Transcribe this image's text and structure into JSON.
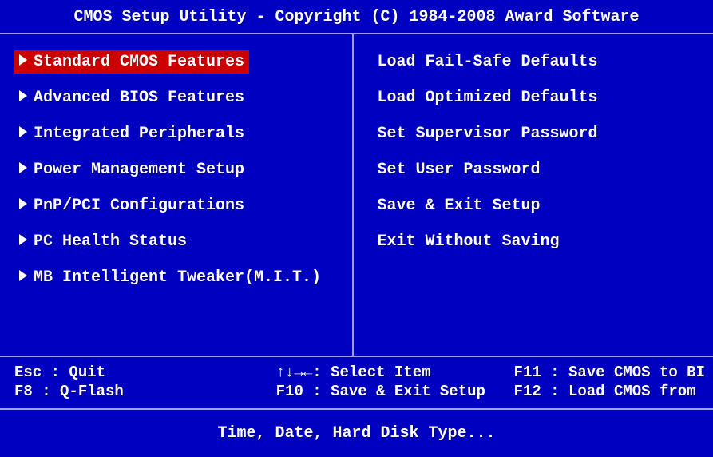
{
  "title": "CMOS Setup Utility - Copyright (C) 1984-2008 Award Software",
  "left_menu": [
    {
      "label": "Standard CMOS Features",
      "selected": true
    },
    {
      "label": "Advanced BIOS Features",
      "selected": false
    },
    {
      "label": "Integrated Peripherals",
      "selected": false
    },
    {
      "label": "Power Management Setup",
      "selected": false
    },
    {
      "label": "PnP/PCI Configurations",
      "selected": false
    },
    {
      "label": "PC Health Status",
      "selected": false
    },
    {
      "label": "MB Intelligent Tweaker(M.I.T.)",
      "selected": false
    }
  ],
  "right_menu": [
    {
      "label": "Load Fail-Safe Defaults"
    },
    {
      "label": "Load Optimized Defaults"
    },
    {
      "label": "Set Supervisor Password"
    },
    {
      "label": "Set User Password"
    },
    {
      "label": "Save & Exit Setup"
    },
    {
      "label": "Exit Without Saving"
    }
  ],
  "help": {
    "esc": "Esc : Quit",
    "f8": "F8  : Q-Flash",
    "arrows": "↑↓→←: Select Item",
    "f10": "F10 : Save & Exit Setup",
    "f11": "F11 : Save CMOS to BI",
    "f12": "F12 : Load CMOS from"
  },
  "status": "Time, Date, Hard Disk Type..."
}
